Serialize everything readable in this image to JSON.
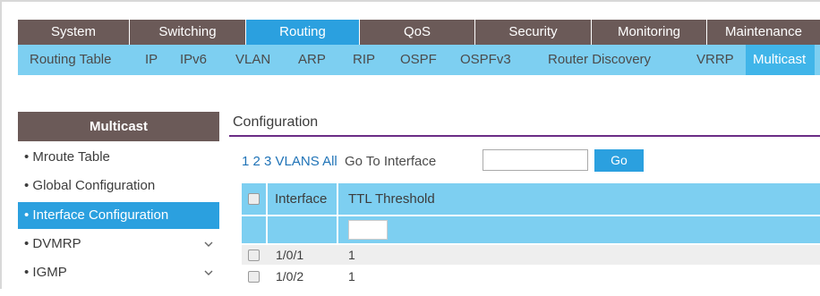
{
  "main_menu": [
    {
      "label": "System"
    },
    {
      "label": "Switching"
    },
    {
      "label": "Routing",
      "active": true
    },
    {
      "label": "QoS"
    },
    {
      "label": "Security"
    },
    {
      "label": "Monitoring"
    },
    {
      "label": "Maintenance"
    }
  ],
  "sub_menu": [
    {
      "label": "Routing Table"
    },
    {
      "label": "IP"
    },
    {
      "label": "IPv6"
    },
    {
      "label": "VLAN"
    },
    {
      "label": "ARP"
    },
    {
      "label": "RIP"
    },
    {
      "label": "OSPF"
    },
    {
      "label": "OSPFv3"
    },
    {
      "label": "Router Discovery"
    },
    {
      "label": "VRRP"
    },
    {
      "label": "Multicast",
      "active": true
    }
  ],
  "sidebar": {
    "title": "Multicast",
    "items": [
      {
        "label": "Mroute Table"
      },
      {
        "label": "Global Configuration"
      },
      {
        "label": "Interface Configuration",
        "active": true
      },
      {
        "label": "DVMRP",
        "expandable": true
      },
      {
        "label": "IGMP",
        "expandable": true
      }
    ]
  },
  "content": {
    "title": "Configuration",
    "pager": {
      "pages": [
        "1",
        "2",
        "3"
      ],
      "vlans": "VLANS",
      "all": "All",
      "goto_label": "Go To Interface",
      "goto_value": "",
      "go_button": "Go"
    },
    "table": {
      "headers": [
        "Interface",
        "TTL Threshold"
      ],
      "ttl_filter_value": "",
      "rows": [
        {
          "interface": "1/0/1",
          "ttl": "1"
        },
        {
          "interface": "1/0/2",
          "ttl": "1"
        }
      ]
    }
  },
  "colors": {
    "main_menu_bg": "#6b5a58",
    "accent_blue": "#2ba0df",
    "sub_menu_bg": "#7dcff1",
    "title_underline": "#6b2d86"
  }
}
